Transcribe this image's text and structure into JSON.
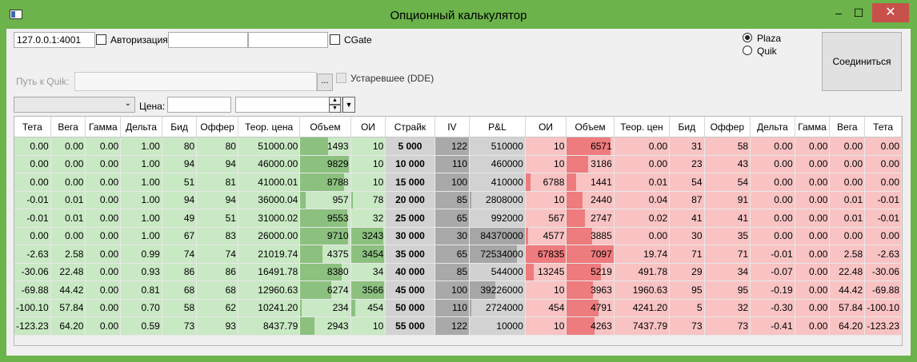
{
  "window": {
    "title": "Опционный калькулятор",
    "min": "–",
    "max": "☐",
    "close": "✕"
  },
  "conn": {
    "address": "127.0.0.1:4001",
    "auth_label": "Авторизация",
    "login": "",
    "password": "",
    "cgate_label": "CGate",
    "plaza_label": "Plaza",
    "quik_label": "Quik",
    "connect_label": "Соединиться",
    "quik_path_label": "Путь к Quik:",
    "quik_path": "",
    "browse_label": "...",
    "dde_label": "Устаревшее (DDE)",
    "price_label": "Цена:",
    "price": "",
    "security": ""
  },
  "table": {
    "headers": [
      "Тета",
      "Вега",
      "Гамма",
      "Дельта",
      "Бид",
      "Оффер",
      "Теор. цена",
      "Объем",
      "ОИ",
      "Страйк",
      "IV",
      "P&L",
      "ОИ",
      "Объем",
      "Теор. цен",
      "Бид",
      "Оффер",
      "Дельта",
      "Гамма",
      "Вега",
      "Тета"
    ],
    "rows": [
      [
        "0.00",
        "0.00",
        "0.00",
        "1.00",
        "80",
        "80",
        "51000.00",
        "1493",
        "10",
        "5 000",
        "122",
        "510000",
        "10",
        "6571",
        "0.00",
        "31",
        "58",
        "0.00",
        "0.00",
        "0.00",
        "0.00"
      ],
      [
        "0.00",
        "0.00",
        "0.00",
        "1.00",
        "94",
        "94",
        "46000.00",
        "9829",
        "10",
        "10 000",
        "110",
        "460000",
        "10",
        "3186",
        "0.00",
        "23",
        "43",
        "0.00",
        "0.00",
        "0.00",
        "0.00"
      ],
      [
        "0.00",
        "0.00",
        "0.00",
        "1.00",
        "51",
        "81",
        "41000.01",
        "8788",
        "10",
        "15 000",
        "100",
        "410000",
        "6788",
        "1441",
        "0.01",
        "54",
        "54",
        "0.00",
        "0.00",
        "0.00",
        "0.00"
      ],
      [
        "-0.01",
        "0.01",
        "0.00",
        "1.00",
        "94",
        "94",
        "36000.04",
        "957",
        "78",
        "20 000",
        "85",
        "2808000",
        "10",
        "2440",
        "0.04",
        "87",
        "91",
        "0.00",
        "0.00",
        "0.01",
        "-0.01"
      ],
      [
        "-0.01",
        "0.01",
        "0.00",
        "1.00",
        "49",
        "51",
        "31000.02",
        "9553",
        "32",
        "25 000",
        "65",
        "992000",
        "567",
        "2747",
        "0.02",
        "41",
        "41",
        "0.00",
        "0.00",
        "0.01",
        "-0.01"
      ],
      [
        "0.00",
        "0.00",
        "0.00",
        "1.00",
        "67",
        "83",
        "26000.00",
        "9710",
        "3243",
        "30 000",
        "30",
        "84370000",
        "4577",
        "3885",
        "0.00",
        "30",
        "35",
        "0.00",
        "0.00",
        "0.00",
        "0.00"
      ],
      [
        "-2.63",
        "2.58",
        "0.00",
        "0.99",
        "74",
        "74",
        "21019.74",
        "4375",
        "3454",
        "35 000",
        "65",
        "72534000",
        "67835",
        "7097",
        "19.74",
        "71",
        "71",
        "-0.01",
        "0.00",
        "2.58",
        "-2.63"
      ],
      [
        "-30.06",
        "22.48",
        "0.00",
        "0.93",
        "86",
        "86",
        "16491.78",
        "8380",
        "34",
        "40 000",
        "85",
        "544000",
        "13245",
        "5219",
        "491.78",
        "29",
        "34",
        "-0.07",
        "0.00",
        "22.48",
        "-30.06"
      ],
      [
        "-69.88",
        "44.42",
        "0.00",
        "0.81",
        "68",
        "68",
        "12960.63",
        "6274",
        "3566",
        "45 000",
        "100",
        "39226000",
        "10",
        "3963",
        "1960.63",
        "95",
        "95",
        "-0.19",
        "0.00",
        "44.42",
        "-69.88"
      ],
      [
        "-100.10",
        "57.84",
        "0.00",
        "0.70",
        "58",
        "62",
        "10241.20",
        "234",
        "454",
        "50 000",
        "110",
        "2724000",
        "454",
        "4791",
        "4241.20",
        "5",
        "32",
        "-0.30",
        "0.00",
        "57.84",
        "-100.10"
      ],
      [
        "-123.23",
        "64.20",
        "0.00",
        "0.59",
        "73",
        "93",
        "8437.79",
        "2943",
        "10",
        "55 000",
        "122",
        "10000",
        "10",
        "4263",
        "7437.79",
        "73",
        "73",
        "-0.41",
        "0.00",
        "64.20",
        "-123.23"
      ]
    ],
    "bars": {
      "call_volume": [
        0.55,
        0.97,
        0.87,
        0.1,
        0.94,
        0.96,
        0.45,
        0.83,
        0.62,
        0.03,
        0.29
      ],
      "call_oi": [
        0.0,
        0.0,
        0.0,
        0.06,
        0.0,
        0.95,
        0.96,
        0.0,
        0.97,
        0.13,
        0.0
      ],
      "iv": [
        0.97,
        0.88,
        0.8,
        0.68,
        0.52,
        0.24,
        0.52,
        0.68,
        0.8,
        0.88,
        0.97
      ],
      "pl": [
        0.0,
        0.0,
        0.0,
        0.03,
        0.0,
        1.0,
        0.86,
        0.0,
        0.46,
        0.03,
        0.0
      ],
      "put_oi": [
        0.0,
        0.0,
        0.12,
        0.0,
        0.0,
        0.07,
        1.0,
        0.2,
        0.0,
        0.0,
        0.0
      ],
      "put_volume": [
        0.93,
        0.45,
        0.2,
        0.34,
        0.39,
        0.55,
        1.0,
        0.73,
        0.56,
        0.68,
        0.6
      ]
    }
  }
}
